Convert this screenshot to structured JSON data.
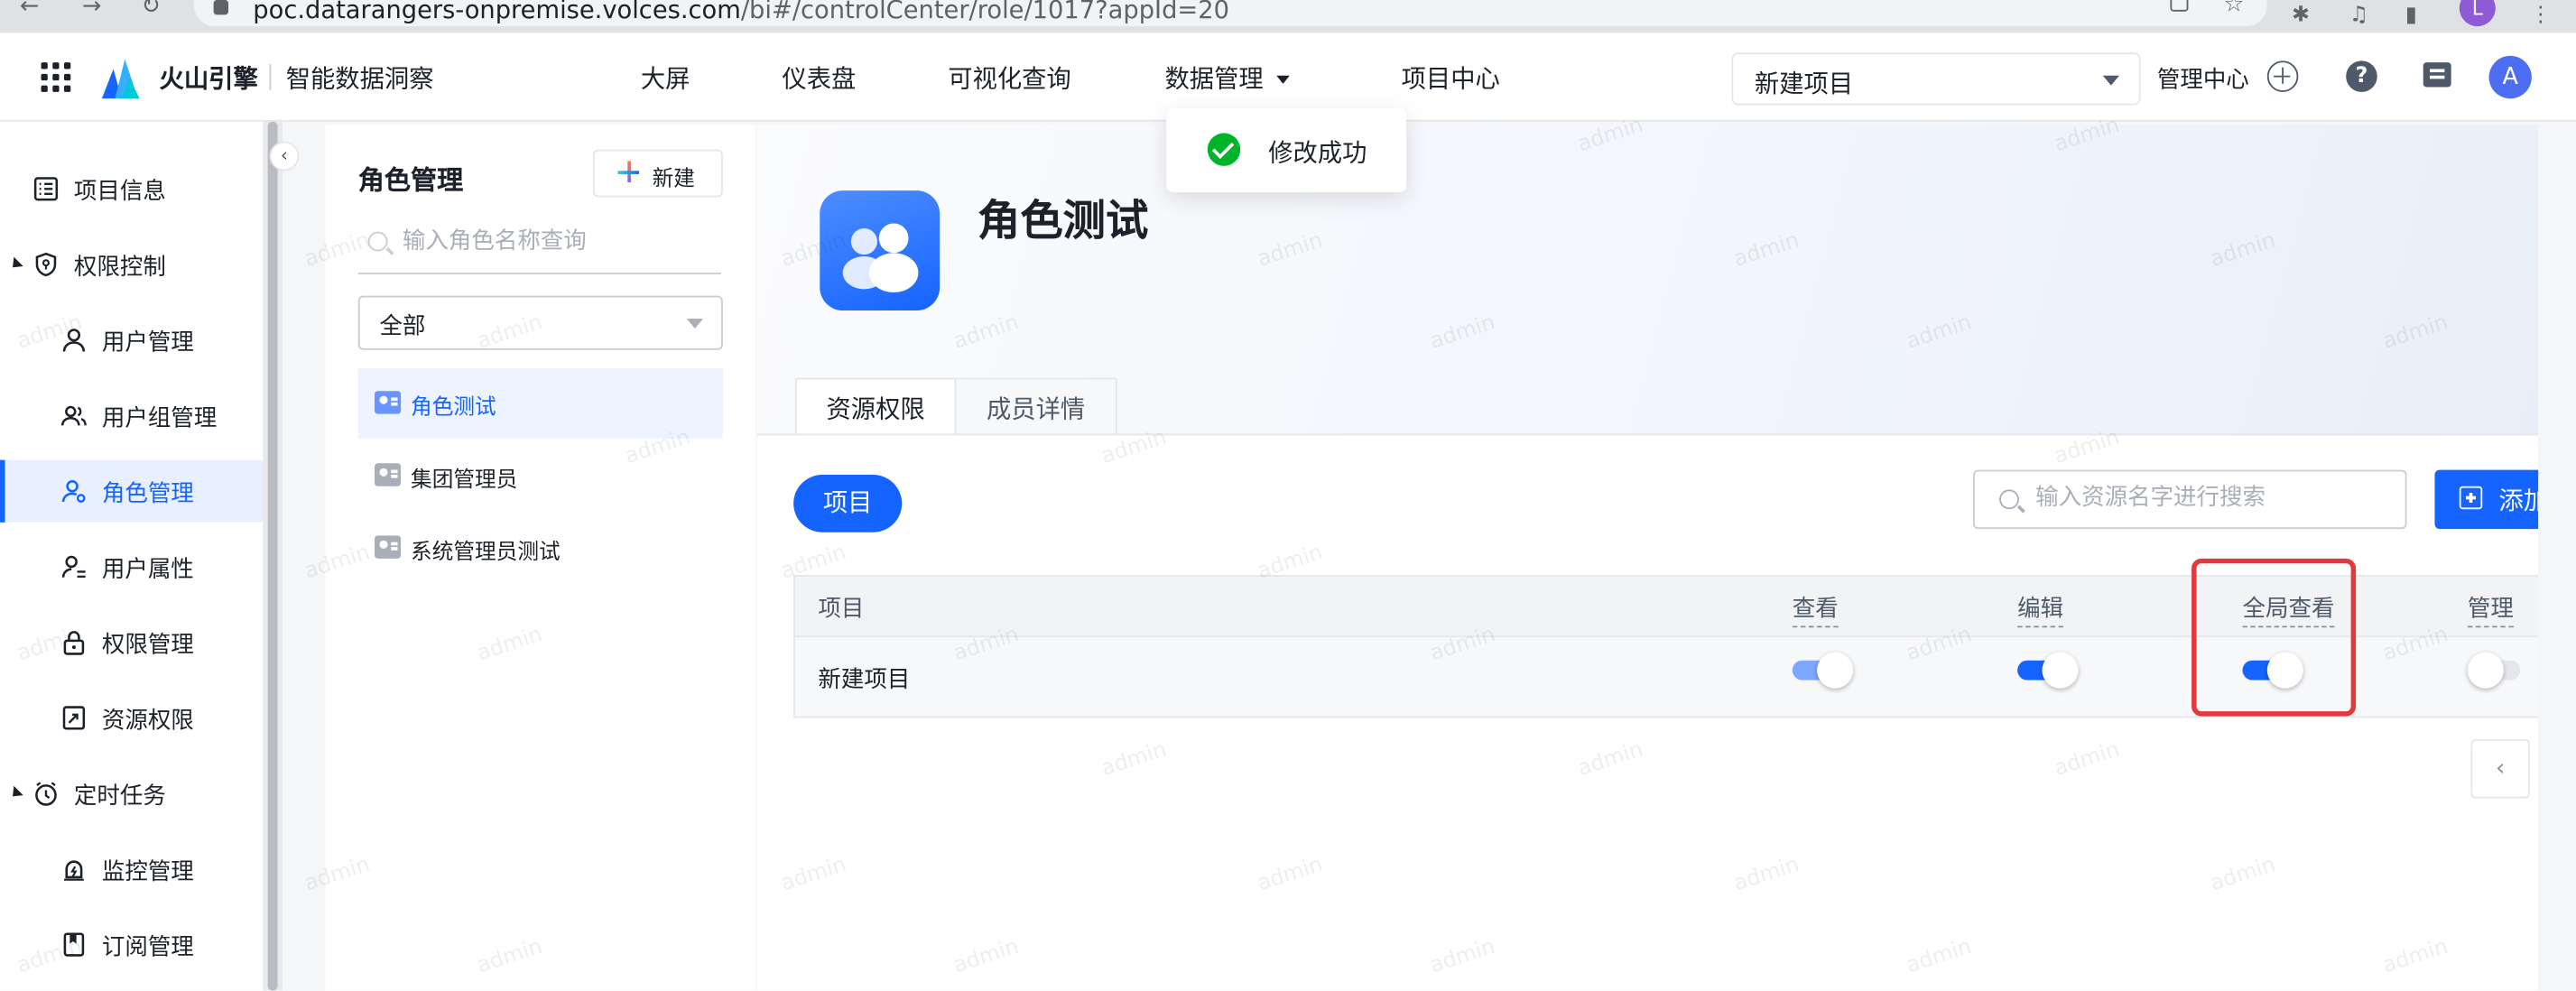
{
  "browser": {
    "url_host": "poc.datarangers-onpremise.volces.com",
    "url_path": "/bi#/controlCenter/role/1017?appId=20",
    "profile_initial": "L"
  },
  "topnav": {
    "brand": "火山引擎",
    "product": "智能数据洞察",
    "menu": [
      {
        "label": "大屏"
      },
      {
        "label": "仪表盘"
      },
      {
        "label": "可视化查询"
      },
      {
        "label": "数据管理"
      },
      {
        "label": "项目中心"
      }
    ],
    "project_select": "新建项目",
    "mgmt_center": "管理中心",
    "help_glyph": "?",
    "user_initial": "A"
  },
  "sidebar": {
    "items": [
      {
        "label": "项目信息",
        "icon": "list-icon"
      },
      {
        "label": "权限控制",
        "icon": "shield-icon",
        "group": true
      },
      {
        "label": "用户管理",
        "icon": "user-icon"
      },
      {
        "label": "用户组管理",
        "icon": "users-icon"
      },
      {
        "label": "角色管理",
        "icon": "role-icon",
        "active": true
      },
      {
        "label": "用户属性",
        "icon": "user-attr-icon"
      },
      {
        "label": "权限管理",
        "icon": "lock-icon"
      },
      {
        "label": "资源权限",
        "icon": "resource-icon"
      },
      {
        "label": "定时任务",
        "icon": "clock-icon",
        "group": true
      },
      {
        "label": "监控管理",
        "icon": "monitor-icon"
      },
      {
        "label": "订阅管理",
        "icon": "bookmark-icon"
      }
    ]
  },
  "roles_panel": {
    "title": "角色管理",
    "new_label": "新建",
    "search_placeholder": "输入角色名称查询",
    "filter_value": "全部",
    "roles": [
      {
        "label": "角色测试",
        "active": true
      },
      {
        "label": "集团管理员"
      },
      {
        "label": "系统管理员测试"
      }
    ]
  },
  "role_detail": {
    "name": "角色测试",
    "tabs": [
      {
        "label": "资源权限",
        "active": true
      },
      {
        "label": "成员详情"
      }
    ],
    "pill": "项目",
    "resource_search_placeholder": "输入资源名字进行搜索",
    "add_label": "添加",
    "table": {
      "columns": [
        "项目",
        "查看",
        "编辑",
        "全局查看",
        "管理"
      ],
      "rows": [
        {
          "name": "新建项目",
          "view": true,
          "edit": true,
          "global_view": true,
          "manage": false
        }
      ]
    },
    "pager_prev": "‹"
  },
  "toast": {
    "message": "修改成功"
  },
  "watermark": "admin",
  "colors": {
    "primary": "#1664ff",
    "success": "#00b42a",
    "highlight": "#e3393c"
  }
}
